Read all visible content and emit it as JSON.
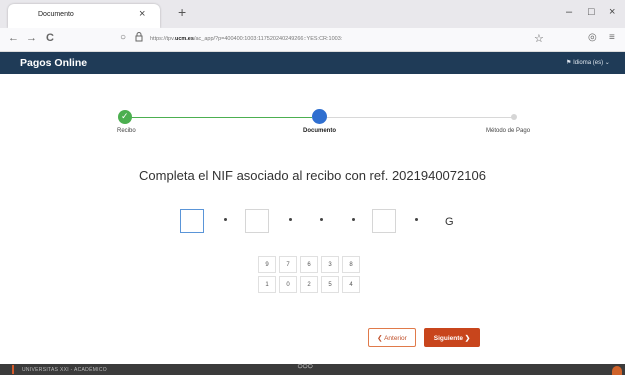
{
  "browser": {
    "tab_title": "Documento",
    "tab_close": "×",
    "new_tab": "+",
    "back": "←",
    "forward": "→",
    "reload": "C",
    "url_prefix": "https://tpv.",
    "url_host": "ucm.es",
    "url_rest": "/ac_app/?p=400400:1003:117520240249266::YES:CR:1003:",
    "minimize": "–",
    "maximize": "□",
    "close": "×"
  },
  "app": {
    "title": "Pagos Online",
    "language_label": "Idioma (es) ⌄"
  },
  "stepper": {
    "steps": [
      {
        "label": "Recibo",
        "state": "done"
      },
      {
        "label": "Documento",
        "state": "current"
      },
      {
        "label": "Método de Pago",
        "state": "pending"
      }
    ],
    "done_check": "✓"
  },
  "form": {
    "headline": "Completa el NIF asociado al recibo con ref. 2021940072106",
    "nif_letter": "G"
  },
  "keypad": {
    "keys": [
      "9",
      "7",
      "6",
      "3",
      "8",
      "1",
      "0",
      "2",
      "5",
      "4"
    ]
  },
  "actions": {
    "previous_label": "❮ Anterior",
    "next_label": "Siguiente ❯"
  },
  "footer": {
    "text": "UNIVERSITAS XXI - ACADÉMICO",
    "logo": "○○○"
  },
  "colors": {
    "header_bg": "#1f3b57",
    "step_done": "#4caf50",
    "step_current": "#2f6fd0",
    "primary_button": "#c8451c",
    "footer_bg": "#3b3b3b"
  }
}
